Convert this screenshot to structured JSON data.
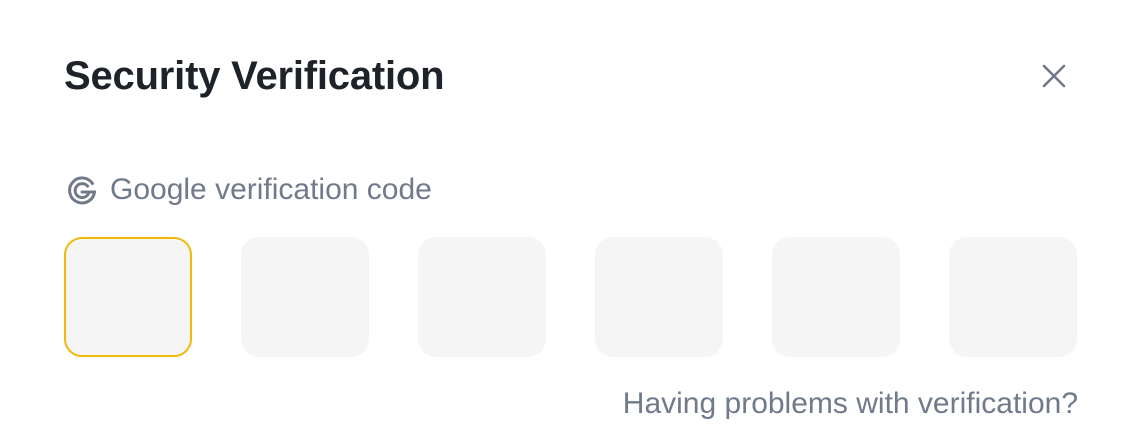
{
  "modal": {
    "title": "Security Verification",
    "close_icon": "close-icon"
  },
  "google_section": {
    "icon": "google-icon",
    "label": "Google verification code"
  },
  "code_inputs": [
    {
      "value": "",
      "focused": true
    },
    {
      "value": "",
      "focused": false
    },
    {
      "value": "",
      "focused": false
    },
    {
      "value": "",
      "focused": false
    },
    {
      "value": "",
      "focused": false
    },
    {
      "value": "",
      "focused": false
    }
  ],
  "help_link": {
    "label": "Having problems with verification?"
  },
  "colors": {
    "accent": "#f0b90b",
    "input_bg": "#f5f5f5",
    "muted_text": "#707a8a",
    "title_text": "#1e2329"
  }
}
